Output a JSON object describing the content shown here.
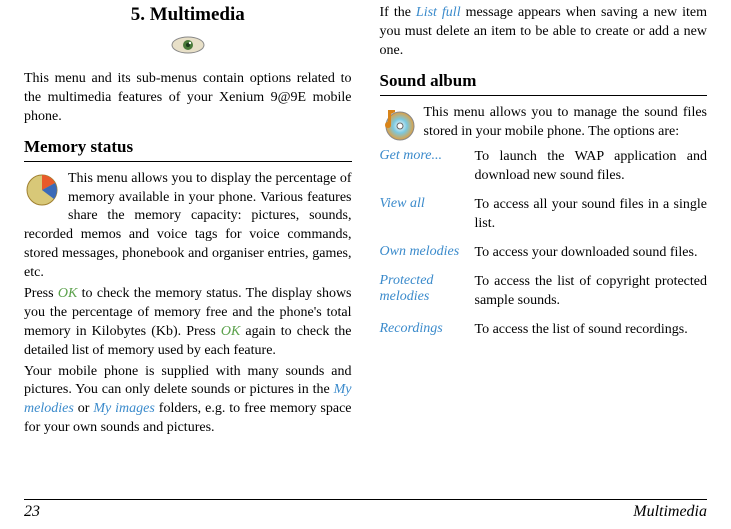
{
  "left": {
    "chapter_title": "5. Multimedia",
    "intro": "This menu and its sub-menus contain options related to the multimedia features of your Xenium 9@9E mobile phone.",
    "mem_heading": "Memory status",
    "mem_p1a": "This menu allows you to display the percentage of memory available in your phone. Various features share the memory capacity: pictures, sounds, recorded memos and voice tags for voice commands, stored messages, phonebook and organiser entries, games, etc.",
    "mem_p2a": "Press ",
    "ok1": "OK",
    "mem_p2b": " to check the memory status. The display shows you the percentage of memory free and the phone's total memory in Kilobytes (Kb). Press ",
    "ok2": "OK",
    "mem_p2c": " again to check the detailed list of memory used by each feature.",
    "mem_p3a": "Your mobile phone is supplied with many sounds and pictures. You can only delete sounds or pictures in the ",
    "my_melodies": "My melodies",
    "mem_p3b": " or ",
    "my_images": "My images",
    "mem_p3c": " folders, e.g. to free memory space for your own sounds and pictures."
  },
  "right": {
    "carry_a": "If the ",
    "list_full": "List full",
    "carry_b": " message appears when saving a new item you must delete an item to be able to create or add a new one.",
    "sound_heading": "Sound album",
    "sound_intro": "This menu allows you to manage the sound files stored in your mobile phone. The options are:",
    "rows": {
      "r0k": "Get more...",
      "r0v": "To launch the WAP application and download new sound files.",
      "r1k": "View all",
      "r1v": "To access all your sound files in a single list.",
      "r2k": "Own melodies",
      "r2v": "To access your downloaded sound files.",
      "r3k": "Protected melodies",
      "r3v": "To access the list of copyright protected sample sounds.",
      "r4k": "Recordings",
      "r4v": "To access the list of sound recordings."
    }
  },
  "footer": {
    "page": "23",
    "section": "Multimedia"
  }
}
